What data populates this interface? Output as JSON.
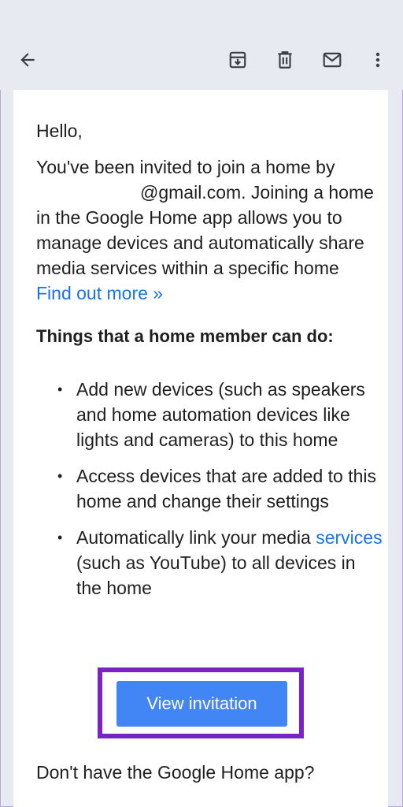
{
  "toolbar": {
    "back": "arrow-back-icon",
    "archive": "archive-icon",
    "delete": "delete-icon",
    "mark_unread": "mail-icon",
    "more": "more-vert-icon"
  },
  "email": {
    "greeting": "Hello,",
    "intro_prefix": "You've been invited to join a home by",
    "intro_email": "@gmail.com. Joining a home in the Google Home app allows you to manage devices and automatically share media services within a specific home",
    "find_out_more": "Find out more »",
    "heading": "Things that a home member can do:",
    "bullets": [
      {
        "text": "Add new devices (such as speakers and home automation devices like lights and cameras) to this home"
      },
      {
        "text": "Access devices that are added to this home and change their settings"
      },
      {
        "pre": "Automatically link your media",
        "link": "services",
        "post": "(such as YouTube) to all devices in the home"
      }
    ],
    "bullet_symbol": "•",
    "cta_label": "View invitation",
    "footer_question": "Don't have the Google Home app?"
  },
  "colors": {
    "toolbar_bg": "#e8eaf2",
    "link": "#1a73e8",
    "button": "#4285f4",
    "highlight": "#7b22c4"
  }
}
